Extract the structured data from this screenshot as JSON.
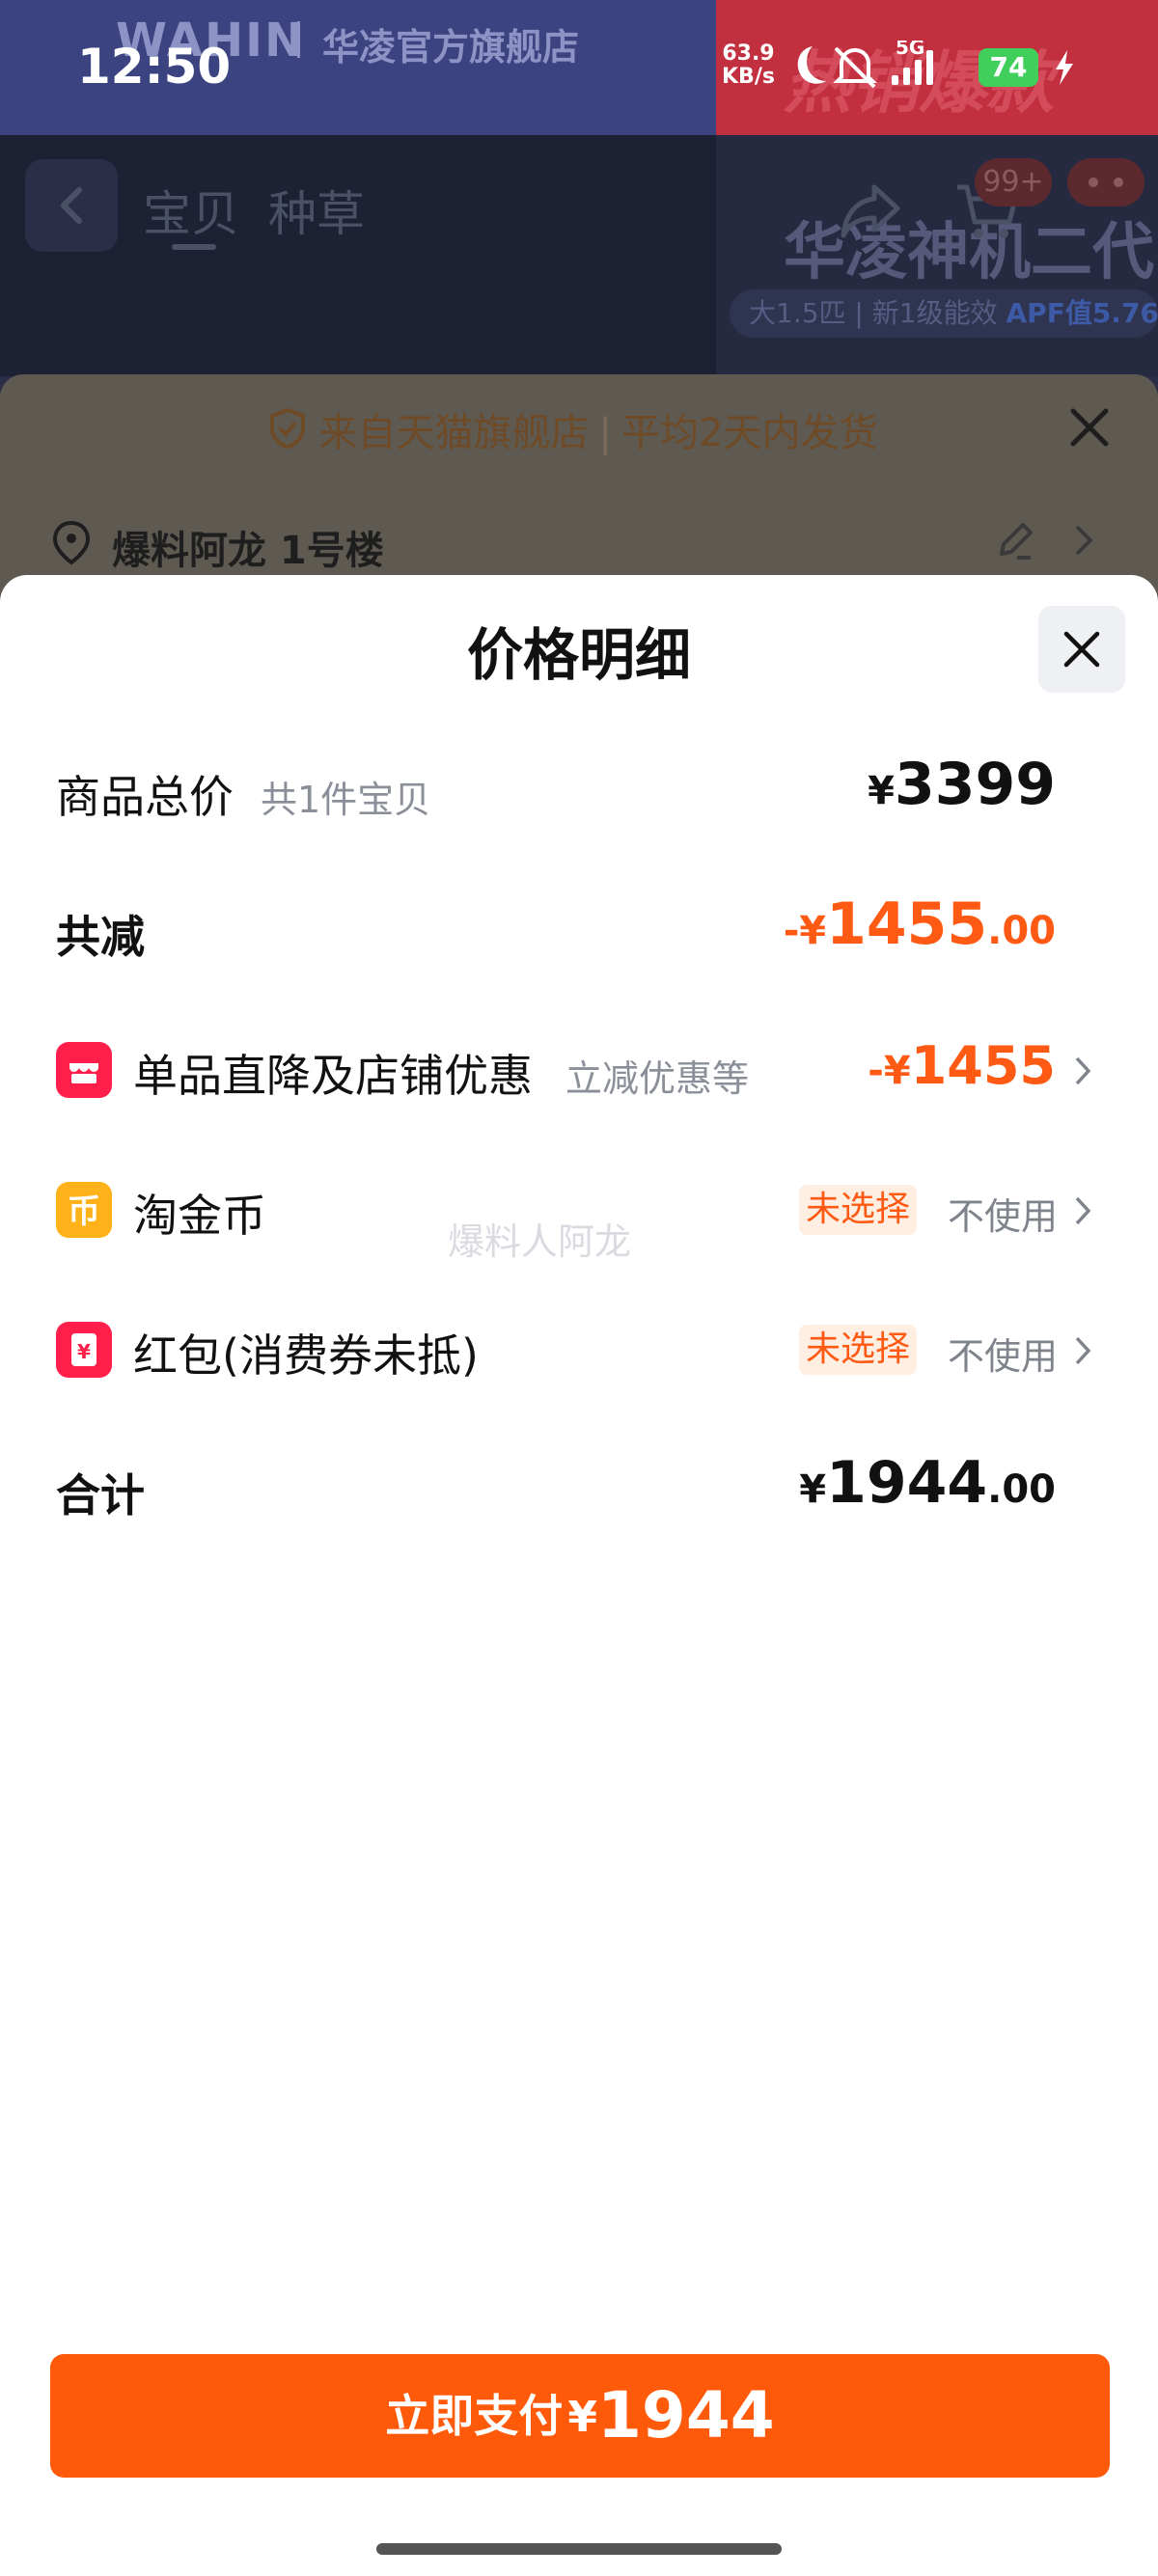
{
  "status_bar": {
    "time": "12:50",
    "net_speed_value": "63.9",
    "net_speed_unit": "KB/s",
    "network": "5G",
    "battery": "74",
    "icons": [
      "moon-icon",
      "mute-icon",
      "signal-icon",
      "battery-icon",
      "charging-icon"
    ]
  },
  "background": {
    "brand_logo": "WAHIN",
    "brand_shop": "华凌官方旗舰店",
    "promo_text": "热销爆款",
    "tabs": [
      "宝贝",
      "种草"
    ],
    "cart_badge": "99+",
    "product_title": "华凌神机二代",
    "spec_text": "大1.5匹 | 新1级能效",
    "spec_highlight": "APF值5.76",
    "notice_left": "来自天猫旗舰店",
    "notice_sep": "|",
    "notice_right": "平均2天内发货",
    "address": "爆料阿龙 1号楼"
  },
  "sheet": {
    "title": "价格明细",
    "rows": {
      "total": {
        "label": "商品总价",
        "sub": "共1件宝贝",
        "currency": "¥",
        "amount_int": "3399"
      },
      "discount": {
        "label": "共减",
        "prefix": "-¥",
        "amount_int": "1455",
        "amount_dec": ".00"
      },
      "promo": {
        "label": "单品直降及店铺优惠",
        "sub": "立减优惠等",
        "prefix": "-¥",
        "amount_int": "1455"
      },
      "coin": {
        "label": "淘金币",
        "tag": "未选择",
        "status": "不使用"
      },
      "redpacket": {
        "label": "红包(消费券未抵)",
        "tag": "未选择",
        "status": "不使用"
      },
      "sum": {
        "label": "合计",
        "currency": "¥",
        "amount_int": "1944",
        "amount_dec": ".00"
      }
    },
    "watermark": "爆料人阿龙",
    "pay_button": {
      "label": "立即支付",
      "currency": "¥",
      "amount": "1944"
    }
  },
  "colors": {
    "accent": "#ff5a14",
    "pay_button": "#ff5a0a",
    "tag_bg": "#ffeee2",
    "promo_icon": "#ff1f4a",
    "coin_icon": "#ffb21a",
    "redpacket_icon": "#ff1f4a"
  }
}
